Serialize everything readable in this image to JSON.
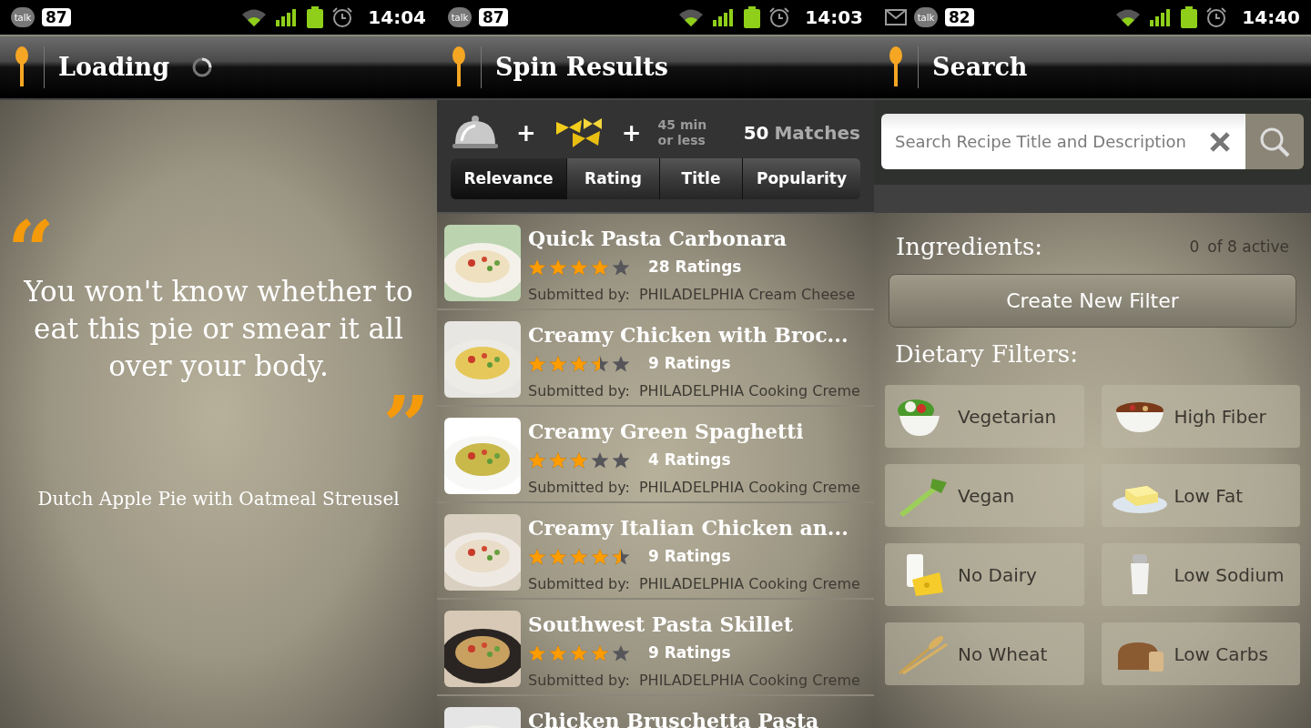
{
  "loading_screen": {
    "status_bar": {
      "notifications": [
        {
          "kind": "talk",
          "text": "talk"
        },
        {
          "kind": "count",
          "text": "87"
        }
      ],
      "time": "14:04"
    },
    "title": "Loading",
    "quote": {
      "open_mark": "“",
      "text": "You won't know whether to eat this pie or smear it all over your body.",
      "close_mark": "”",
      "recipe": "Dutch Apple Pie with Oatmeal Streusel"
    }
  },
  "results_screen": {
    "status_bar": {
      "notifications": [
        {
          "kind": "talk",
          "text": "talk"
        },
        {
          "kind": "count",
          "text": "87"
        }
      ],
      "time": "14:03"
    },
    "title": "Spin Results",
    "criteria": [
      {
        "kind": "cloche"
      },
      {
        "kind": "pasta",
        "plus": "+"
      },
      {
        "kind": "time",
        "plus": "+",
        "lines": [
          "45 min",
          "or less"
        ]
      }
    ],
    "match_count": "50",
    "match_label": "Matches",
    "sort_tabs": [
      {
        "label": "Relevance",
        "selected": true
      },
      {
        "label": "Rating",
        "selected": false
      },
      {
        "label": "Title",
        "selected": false
      },
      {
        "label": "Popularity",
        "selected": false
      }
    ],
    "recipes": [
      {
        "title": "Quick Pasta Carbonara",
        "stars": 4,
        "ratings": "28 Ratings",
        "submitted_label": "Submitted by:",
        "submitter": "PHILADELPHIA Cream Cheese"
      },
      {
        "title": "Creamy Chicken with Broc...",
        "stars": 3.5,
        "ratings": "9 Ratings",
        "submitted_label": "Submitted by:",
        "submitter": "PHILADELPHIA Cooking Creme"
      },
      {
        "title": "Creamy Green Spaghetti",
        "stars": 3,
        "ratings": "4 Ratings",
        "submitted_label": "Submitted by:",
        "submitter": "PHILADELPHIA Cooking Creme"
      },
      {
        "title": "Creamy Italian Chicken an...",
        "stars": 4.5,
        "ratings": "9 Ratings",
        "submitted_label": "Submitted by:",
        "submitter": "PHILADELPHIA Cooking Creme"
      },
      {
        "title": "Southwest Pasta Skillet",
        "stars": 4,
        "ratings": "9 Ratings",
        "submitted_label": "Submitted by:",
        "submitter": "PHILADELPHIA Cooking Creme"
      },
      {
        "title": "Chicken Bruschetta Pasta"
      }
    ]
  },
  "search_screen": {
    "status_bar": {
      "notifications": [
        {
          "kind": "mail"
        },
        {
          "kind": "talk",
          "text": "talk"
        },
        {
          "kind": "count",
          "text": "82"
        }
      ],
      "time": "14:40"
    },
    "title": "Search",
    "search": {
      "placeholder": "Search Recipe Title and Description"
    },
    "ingredients": {
      "label": "Ingredients:",
      "count": "0",
      "count_label": "of 8 active",
      "button": "Create New Filter"
    },
    "dietary": {
      "label": "Dietary Filters:",
      "filters": [
        {
          "label": "Vegetarian",
          "kind": "salad"
        },
        {
          "label": "High Fiber",
          "kind": "cereal"
        },
        {
          "label": "Vegan",
          "kind": "celery"
        },
        {
          "label": "Low Fat",
          "kind": "butter"
        },
        {
          "label": "No Dairy",
          "kind": "milk"
        },
        {
          "label": "Low Sodium",
          "kind": "salt"
        },
        {
          "label": "No Wheat",
          "kind": "wheat"
        },
        {
          "label": "Low Carbs",
          "kind": "bread"
        }
      ]
    }
  }
}
